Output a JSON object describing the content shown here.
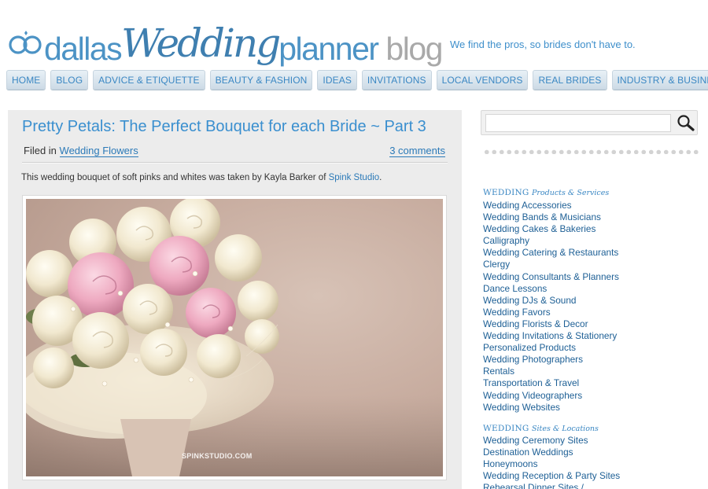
{
  "brand": {
    "logo_prefix": "dallas",
    "logo_script": "Wedding",
    "logo_mid": "planner",
    "logo_suffix": " blog",
    "tagline": "We find the pros, so brides don't have to.",
    "colors": {
      "accent": "#3a8fcf",
      "link": "#1d5f95",
      "grey": "#a9a9a9"
    }
  },
  "nav": {
    "items": [
      "HOME",
      "BLOG",
      "ADVICE & ETIQUETTE",
      "BEAUTY & FASHION",
      "IDEAS",
      "INVITATIONS",
      "LOCAL VENDORS",
      "REAL BRIDES",
      "INDUSTRY & BUSINESS"
    ]
  },
  "post": {
    "title": "Pretty Petals: The Perfect Bouquet for each Bride ~ Part 3",
    "filed_prefix": "Filed in",
    "category": "Wedding Flowers",
    "comments": "3 comments",
    "intro_text": "This wedding bouquet of soft pinks and whites was taken by Kayla Barker of ",
    "intro_link": "Spink Studio",
    "intro_end": ".",
    "photo_watermark": "SPINKSTUDIO.COM"
  },
  "sidebar": {
    "search": {
      "placeholder": "",
      "button_icon": "search-icon"
    },
    "section1": {
      "title": "WEDDING",
      "subtitle": "Products & Services",
      "items": [
        "Wedding Accessories",
        "Wedding Bands & Musicians",
        "Wedding Cakes & Bakeries",
        "Calligraphy",
        "Wedding Catering & Restaurants",
        "Clergy",
        "Wedding Consultants & Planners",
        "Dance Lessons",
        "Wedding DJs & Sound",
        "Wedding Favors",
        "Wedding Florists & Decor",
        "Wedding Invitations & Stationery",
        "Personalized Products",
        "Wedding Photographers",
        "Rentals",
        "Transportation & Travel",
        "Wedding Videographers",
        "Wedding Websites"
      ]
    },
    "section2": {
      "title": "WEDDING",
      "subtitle": "Sites & Locations",
      "items": [
        "Wedding Ceremony Sites",
        "Destination Weddings",
        "Honeymoons",
        "Wedding Reception & Party Sites",
        "Rehearsal Dinner Sites /"
      ]
    }
  }
}
